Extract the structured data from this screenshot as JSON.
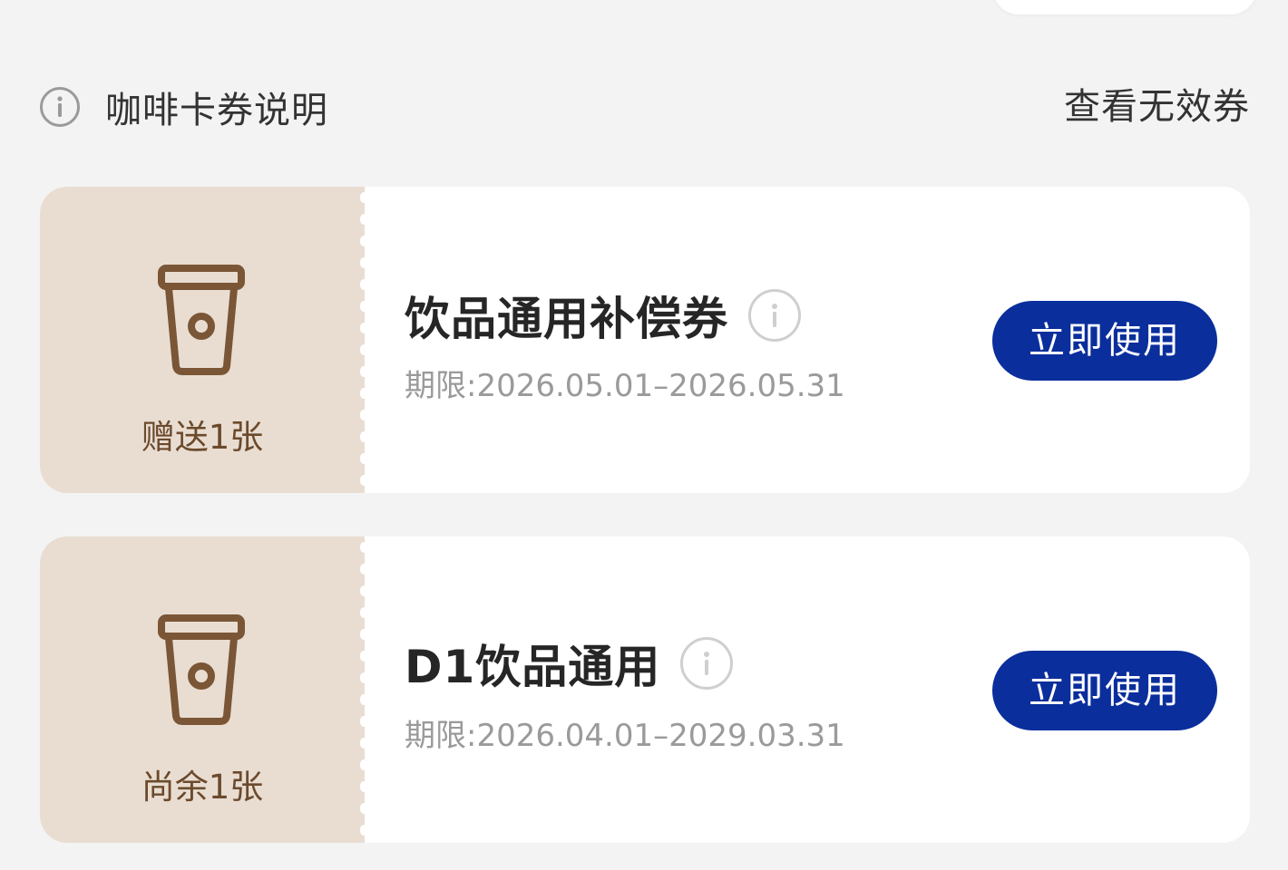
{
  "header": {
    "info_label": "咖啡卡券说明",
    "invalid_link": "查看无效券"
  },
  "coupons": [
    {
      "count_label": "赠送1张",
      "title": "饮品通用补偿券",
      "validity": "期限:2026.05.01–2026.05.31",
      "button_label": "立即使用"
    },
    {
      "count_label": "尚余1张",
      "title": "D1饮品通用",
      "validity": "期限:2026.04.01–2029.03.31",
      "button_label": "立即使用"
    }
  ],
  "colors": {
    "background": "#f3f3f3",
    "card": "#ffffff",
    "stub": "#e9ddd2",
    "cup": "#7a5636",
    "button": "#0a2e9c",
    "muted_text": "#9a9a9a"
  },
  "icons": {
    "info": "info-icon",
    "cup": "coffee-cup-icon"
  }
}
